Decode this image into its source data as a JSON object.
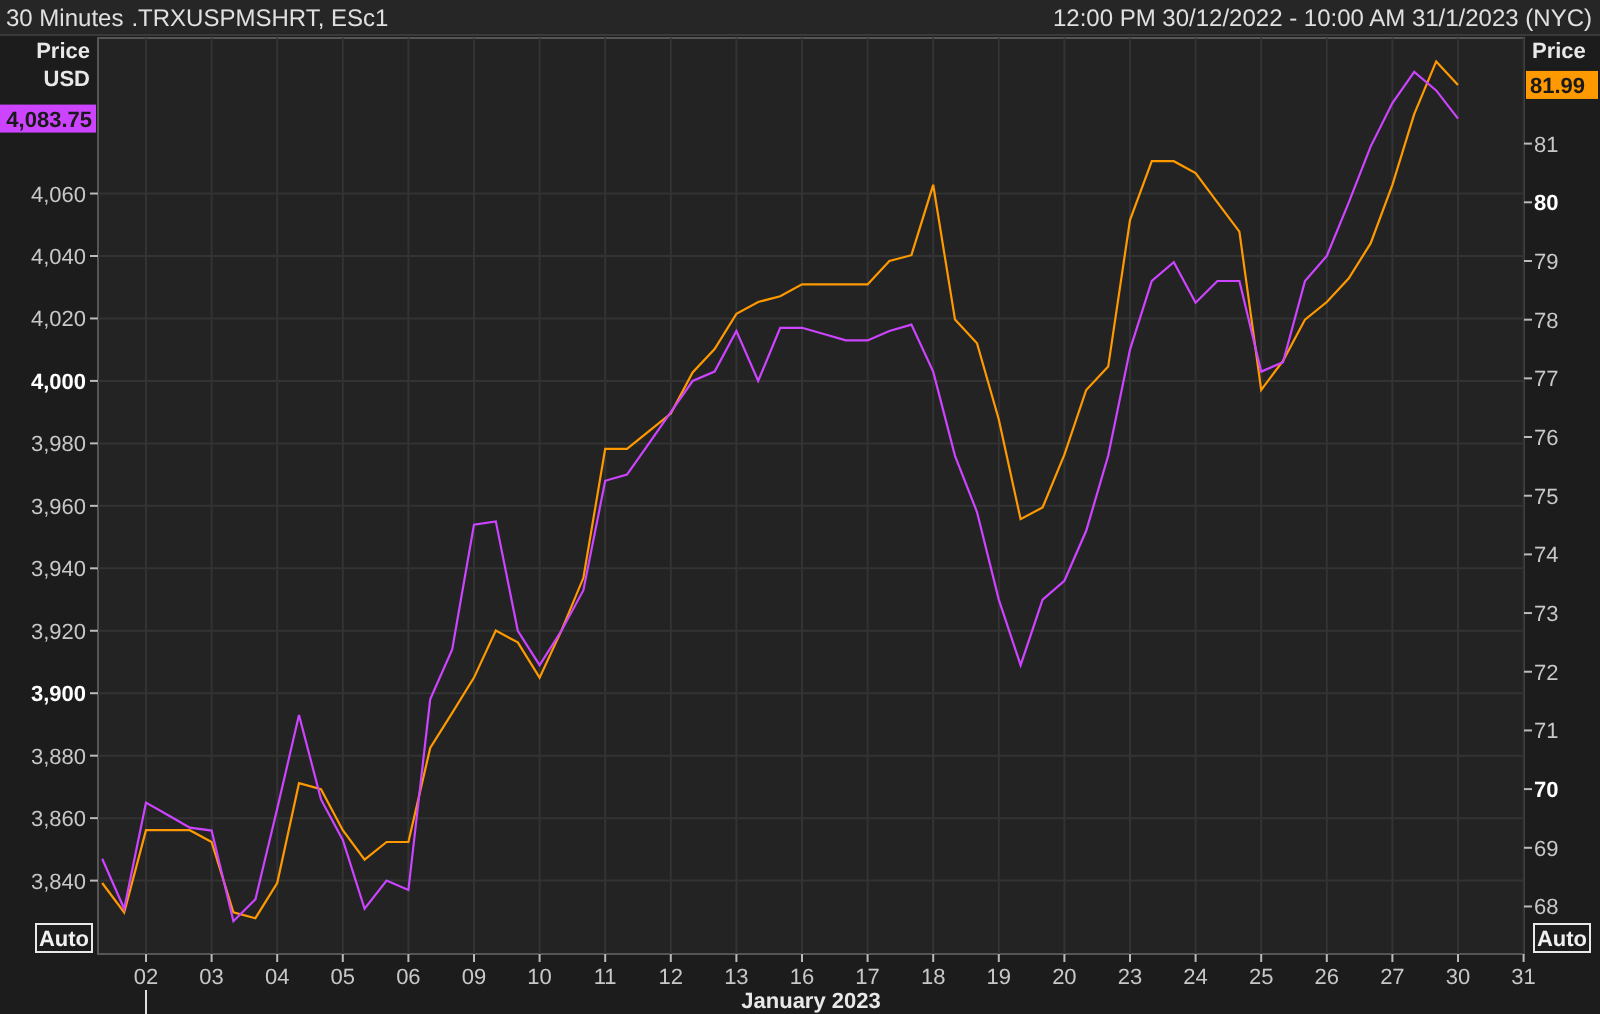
{
  "header": {
    "interval": "30 Minutes",
    "separator": ",",
    "range": "12:00 PM 30/12/2022 - 10:00 AM 31/1/2023 (NYC)"
  },
  "chart": {
    "axis_unit": "USD",
    "last_values": [
      "81.99",
      "4,083.75"
    ],
    "chart_data": {
      "type": "line",
      "xlabel": "January 2023",
      "ylabel": "Price",
      "y2label": "Price",
      "categories": [
        null,
        null,
        "02",
        null,
        null,
        "03",
        null,
        null,
        "04",
        null,
        null,
        "05",
        null,
        null,
        "06",
        null,
        null,
        "09",
        null,
        null,
        "10",
        null,
        null,
        "11",
        null,
        null,
        "12",
        null,
        null,
        "13",
        null,
        null,
        "16",
        null,
        null,
        "17",
        null,
        null,
        "18",
        null,
        null,
        "19",
        null,
        null,
        "20",
        null,
        null,
        "23",
        null,
        null,
        "24",
        null,
        null,
        "25",
        null,
        null,
        "26",
        null,
        null,
        "27",
        null,
        null,
        "30",
        null,
        null,
        "31"
      ],
      "annotations": [
        {
          "x": "02"
        }
      ],
      "grid": true,
      "ylim": [
        3816.5,
        4109.8
      ],
      "yticks": [
        {
          "value": 3840,
          "label": "3,840"
        },
        {
          "value": 3860,
          "label": "3,860"
        },
        {
          "value": 3880,
          "label": "3,880"
        },
        {
          "value": 3900,
          "label": "3,900"
        },
        {
          "value": 3920,
          "label": "3,920"
        },
        {
          "value": 3940,
          "label": "3,940"
        },
        {
          "value": 3960,
          "label": "3,960"
        },
        {
          "value": 3980,
          "label": "3,980"
        },
        {
          "value": 4000,
          "label": "4,000"
        },
        {
          "value": 4020,
          "label": "4,020"
        },
        {
          "value": 4040,
          "label": "4,040"
        },
        {
          "value": 4060,
          "label": "4,060"
        }
      ],
      "y2lim": [
        67.19,
        82.8
      ],
      "y2ticks": [
        68,
        69,
        70,
        71,
        72,
        73,
        74,
        75,
        76,
        77,
        78,
        79,
        80,
        81
      ],
      "series": [
        {
          "name": ".TRXUSPMSHRT",
          "color": "#ff9900",
          "axis": "y2",
          "values": [
            68.4,
            67.9,
            69.3,
            69.3,
            69.3,
            69.1,
            67.9,
            67.8,
            68.4,
            70.1,
            70.0,
            69.3,
            68.8,
            69.1,
            69.1,
            70.7,
            71.3,
            71.9,
            72.7,
            72.5,
            71.9,
            72.7,
            73.6,
            75.8,
            75.8,
            76.1,
            76.4,
            77.1,
            77.5,
            78.1,
            78.3,
            78.4,
            78.6,
            78.6,
            78.6,
            78.6,
            79.0,
            79.1,
            80.3,
            78.0,
            77.6,
            76.3,
            74.6,
            74.8,
            75.7,
            76.8,
            77.2,
            79.7,
            80.7,
            80.7,
            80.5,
            80.0,
            79.5,
            76.8,
            77.3,
            78.0,
            78.3,
            78.7,
            79.3,
            80.3,
            81.5,
            82.4,
            82.0,
            null,
            null,
            null
          ]
        },
        {
          "name": "ESc1",
          "color": "#cc44ff",
          "values": [
            3847,
            3831,
            3865,
            3861,
            3857,
            3856,
            3827,
            3834,
            3863,
            3893,
            3866,
            3853,
            3831,
            3840,
            3837,
            3898,
            3914,
            3954,
            3955,
            3920,
            3909,
            3920,
            3933,
            3968,
            3970,
            3980,
            3990,
            4000,
            4003,
            4016,
            4000,
            4017,
            4017,
            4015,
            4013,
            4013,
            4016,
            4018,
            4003,
            3976,
            3958,
            3930,
            3909,
            3930,
            3936,
            3952,
            3976,
            4010,
            4032,
            4038,
            4025,
            4032,
            4032,
            4003,
            4006,
            4032,
            4040,
            4057,
            4075,
            4089,
            4099,
            4093,
            4084,
            null,
            null,
            null
          ]
        }
      ]
    },
    "auto_buttons": [
      "Auto",
      "Auto"
    ]
  }
}
